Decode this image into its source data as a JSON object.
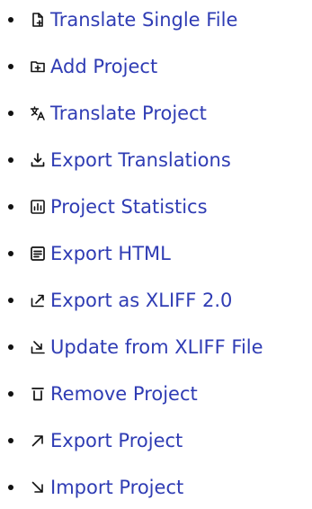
{
  "menu": {
    "items": [
      {
        "label": "Translate Single File",
        "icon": "file-plus-icon"
      },
      {
        "label": "Add Project",
        "icon": "folder-plus-icon"
      },
      {
        "label": "Translate Project",
        "icon": "translate-icon"
      },
      {
        "label": "Export Translations",
        "icon": "download-icon"
      },
      {
        "label": "Project Statistics",
        "icon": "bar-chart-icon"
      },
      {
        "label": "Export HTML",
        "icon": "document-list-icon"
      },
      {
        "label": "Export as XLIFF 2.0",
        "icon": "export-arrow-icon"
      },
      {
        "label": "Update from XLIFF File",
        "icon": "import-arrow-icon"
      },
      {
        "label": "Remove Project",
        "icon": "trash-icon"
      },
      {
        "label": "Export Project",
        "icon": "arrow-up-right-icon"
      },
      {
        "label": "Import Project",
        "icon": "arrow-down-right-icon"
      }
    ]
  },
  "colors": {
    "link": "#2f3cb4",
    "bullet": "#111111",
    "icon": "#111111"
  }
}
